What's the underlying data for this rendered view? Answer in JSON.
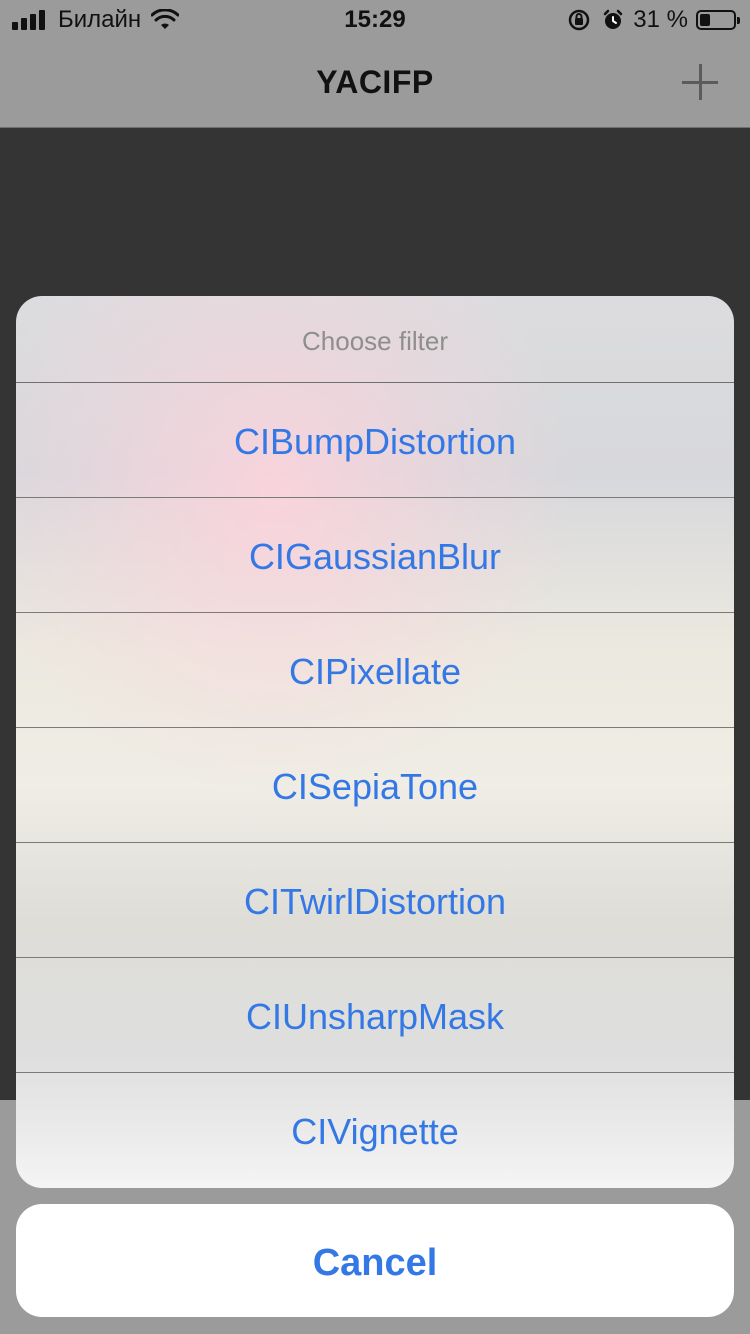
{
  "status_bar": {
    "carrier": "Билайн",
    "time": "15:29",
    "battery_percent": "31 %",
    "battery_level": 0.31
  },
  "nav_bar": {
    "title": "YACIFP",
    "add_icon": "plus-icon"
  },
  "action_sheet": {
    "title": "Choose filter",
    "options": [
      {
        "label": "CIBumpDistortion"
      },
      {
        "label": "CIGaussianBlur"
      },
      {
        "label": "CIPixellate"
      },
      {
        "label": "CISepiaTone"
      },
      {
        "label": "CITwirlDistortion"
      },
      {
        "label": "CIUnsharpMask"
      },
      {
        "label": "CIVignette"
      }
    ],
    "cancel_label": "Cancel"
  },
  "colors": {
    "accent": "#3478e6",
    "overlay": "#343434",
    "chrome": "#9b9b9b",
    "subtitle": "#8e8e8e"
  }
}
